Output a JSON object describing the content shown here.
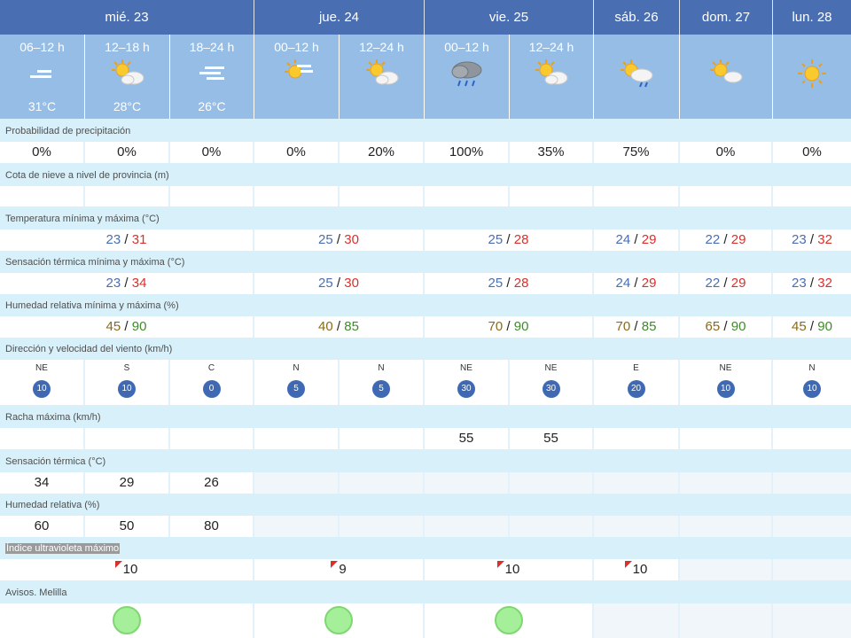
{
  "days": [
    "mié. 23",
    "jue. 24",
    "vie. 25",
    "sáb. 26",
    "dom. 27",
    "lun. 28"
  ],
  "periods": [
    {
      "label": "06–12 h",
      "temp": "31°C",
      "icon": "haze-icon"
    },
    {
      "label": "12–18 h",
      "temp": "28°C",
      "icon": "sun-cloud-icon"
    },
    {
      "label": "18–24 h",
      "temp": "26°C",
      "icon": "haze-icon"
    },
    {
      "label": "00–12 h",
      "temp": "",
      "icon": "sun-haze-icon"
    },
    {
      "label": "12–24 h",
      "temp": "",
      "icon": "sun-cloud-icon"
    },
    {
      "label": "00–12 h",
      "temp": "",
      "icon": "rain-cloud-icon"
    },
    {
      "label": "12–24 h",
      "temp": "",
      "icon": "sun-cloud-icon"
    },
    {
      "label": "",
      "temp": "",
      "icon": "sun-rain-cloud-icon"
    },
    {
      "label": "",
      "temp": "",
      "icon": "sun-cloud-icon"
    },
    {
      "label": "",
      "temp": "",
      "icon": "sun-icon"
    }
  ],
  "labels": {
    "precip": "Probabilidad de precipitación",
    "snow": "Cota de nieve a nivel de provincia (m)",
    "temp": "Temperatura mínima y máxima (°C)",
    "feel": "Sensación térmica mínima y máxima (°C)",
    "hum": "Humedad relativa mínima y máxima (%)",
    "wind": "Dirección y velocidad del viento (km/h)",
    "gust": "Racha máxima (km/h)",
    "feel2": "Sensación térmica (°C)",
    "hum2": "Humedad relativa (%)",
    "uv": "Índice ultravioleta máximo",
    "avisos": "Avisos. Melilla"
  },
  "precip": [
    "0%",
    "0%",
    "0%",
    "0%",
    "20%",
    "100%",
    "35%",
    "75%",
    "0%",
    "0%"
  ],
  "temp": [
    {
      "min": "23",
      "max": "31"
    },
    {
      "min": "25",
      "max": "30"
    },
    {
      "min": "25",
      "max": "28"
    },
    {
      "min": "24",
      "max": "29"
    },
    {
      "min": "22",
      "max": "29"
    },
    {
      "min": "23",
      "max": "32"
    }
  ],
  "feel": [
    {
      "min": "23",
      "max": "34"
    },
    {
      "min": "25",
      "max": "30"
    },
    {
      "min": "25",
      "max": "28"
    },
    {
      "min": "24",
      "max": "29"
    },
    {
      "min": "22",
      "max": "29"
    },
    {
      "min": "23",
      "max": "32"
    }
  ],
  "hum": [
    {
      "min": "45",
      "max": "90"
    },
    {
      "min": "40",
      "max": "85"
    },
    {
      "min": "70",
      "max": "90"
    },
    {
      "min": "70",
      "max": "85"
    },
    {
      "min": "65",
      "max": "90"
    },
    {
      "min": "45",
      "max": "90"
    }
  ],
  "wind": [
    {
      "dir": "NE",
      "speed": "10"
    },
    {
      "dir": "S",
      "speed": "10"
    },
    {
      "dir": "C",
      "speed": "0"
    },
    {
      "dir": "N",
      "speed": "5"
    },
    {
      "dir": "N",
      "speed": "5"
    },
    {
      "dir": "NE",
      "speed": "30"
    },
    {
      "dir": "NE",
      "speed": "30"
    },
    {
      "dir": "E",
      "speed": "20"
    },
    {
      "dir": "NE",
      "speed": "10"
    },
    {
      "dir": "N",
      "speed": "10"
    }
  ],
  "gust": [
    "",
    "",
    "",
    "",
    "",
    "55",
    "55",
    "",
    "",
    ""
  ],
  "feel2": [
    "34",
    "29",
    "26"
  ],
  "hum2": [
    "60",
    "50",
    "80"
  ],
  "uv": [
    "10",
    "9",
    "10",
    "10"
  ],
  "separator": "/"
}
